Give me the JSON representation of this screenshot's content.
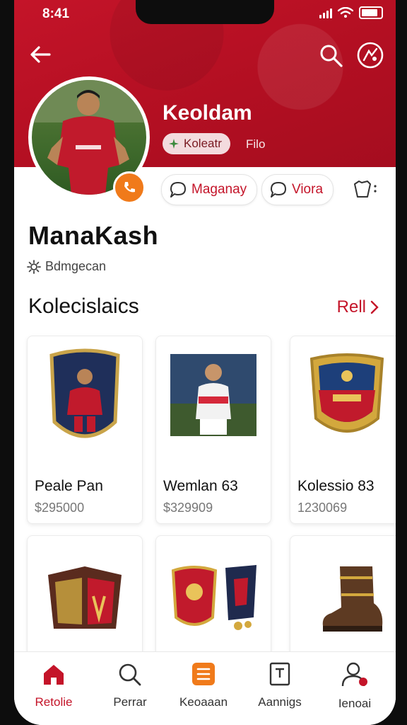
{
  "status_bar": {
    "time": "8:41"
  },
  "header": {
    "display_name": "Keoldam",
    "tag_label": "Koleatr",
    "tag_extra": "Filo"
  },
  "actions": {
    "message_label": "Maganay",
    "view_label": "Viora"
  },
  "profile": {
    "title": "ManaKash",
    "subtitle": "Bdmgecan"
  },
  "collections": {
    "title": "Kolecislaics",
    "see_all": "Rell",
    "items": [
      {
        "name": "Peale Pan",
        "price": "$295000"
      },
      {
        "name": "Wemlan 63",
        "price": "$329909"
      },
      {
        "name": "Kolessio 83",
        "price": "1230069"
      },
      {
        "name": "",
        "price": ""
      },
      {
        "name": "",
        "price": ""
      },
      {
        "name": "",
        "price": ""
      }
    ]
  },
  "tabbar": {
    "items": [
      {
        "label": "Retolie",
        "icon": "home-icon",
        "active": true
      },
      {
        "label": "Perrar",
        "icon": "search-icon",
        "active": false
      },
      {
        "label": "Keoaaan",
        "icon": "list-icon",
        "active": false
      },
      {
        "label": "Aannigs",
        "icon": "document-icon",
        "active": false
      },
      {
        "label": "Ienoai",
        "icon": "profile-icon",
        "active": false
      }
    ]
  },
  "colors": {
    "brand_red": "#c41429",
    "accent_orange": "#f07a1a"
  }
}
